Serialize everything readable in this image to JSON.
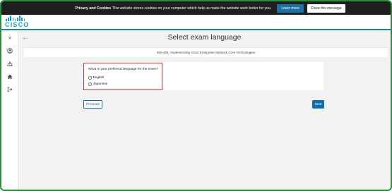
{
  "cookie_banner": {
    "title": "Privacy and Cookies",
    "message": "This website stores cookies on your computer which help us make the website work better for you.",
    "learn_more_label": "Learn more",
    "close_label": "Close this message"
  },
  "brand": {
    "logo_text": "CISCO"
  },
  "sidebar": {
    "items": [
      {
        "icon": "chevrons-right-icon",
        "glyph": "»"
      },
      {
        "icon": "user-icon",
        "glyph": ""
      },
      {
        "icon": "org-chart-icon",
        "glyph": ""
      },
      {
        "icon": "home-icon",
        "glyph": ""
      },
      {
        "icon": "sign-out-icon",
        "glyph": ""
      }
    ]
  },
  "page": {
    "back_glyph": "←",
    "title": "Select exam language",
    "exam_name": "350-401: Implementing Cisco Enterprise Network Core Technologies"
  },
  "question": {
    "text": "What is your preferred language for the exam?",
    "options": [
      {
        "label": "English",
        "selected": false
      },
      {
        "label": "Japanese",
        "selected": false
      }
    ]
  },
  "nav": {
    "previous_label": "Previous",
    "next_label": "Next"
  },
  "colors": {
    "accent": "#1b7fb3",
    "cisco_blue": "#1b9ad6",
    "highlight_border": "#d42b2b",
    "next_button": "#0f6ea8"
  }
}
